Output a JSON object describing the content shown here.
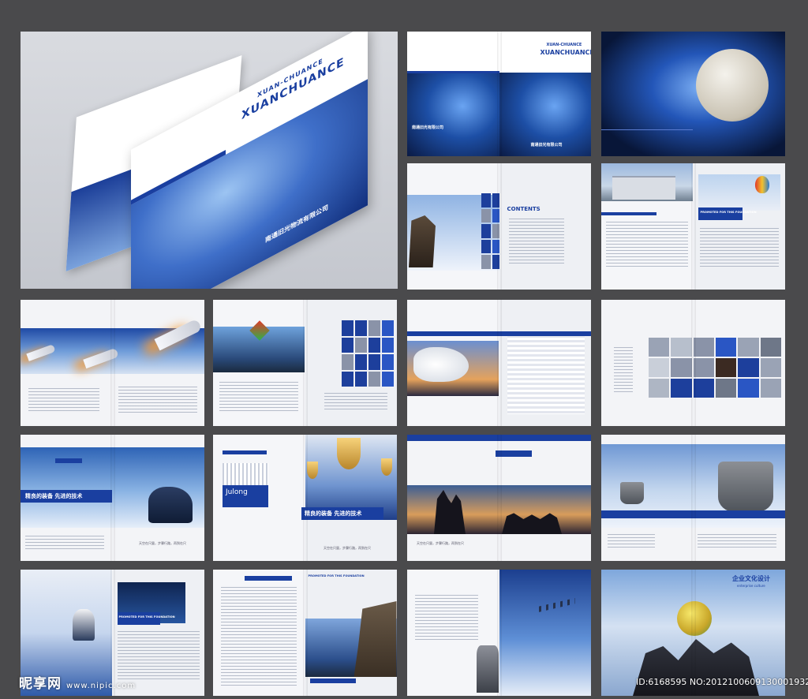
{
  "cover": {
    "brand_line1": "XUAN-CHUANCE",
    "brand_line2": "XUANCHUANCE",
    "company_cn": "南通旧光物流有限公司"
  },
  "spread2": {
    "brand_line1": "XUAN-CHUANCE",
    "brand_line2": "XUANCHUANCE",
    "company_cn": "南通旧光有限公司"
  },
  "contents": {
    "title": "CONTENTS"
  },
  "promo": {
    "line": "PROMOTED FOR THIS FOUNDATION"
  },
  "slogan": {
    "cn": "精良的装备 先进的技术",
    "sub": "天空在尺量，步骤行路，再到在尺"
  },
  "julong": {
    "name": "Julong"
  },
  "culture": {
    "title": "企业文化设计",
    "sub": "enterprise culture"
  },
  "watermark": {
    "site_cn": "昵享网",
    "site_url": "www.nipic.com",
    "id_text": "ID:6168595 NO:20121006091300019324"
  }
}
